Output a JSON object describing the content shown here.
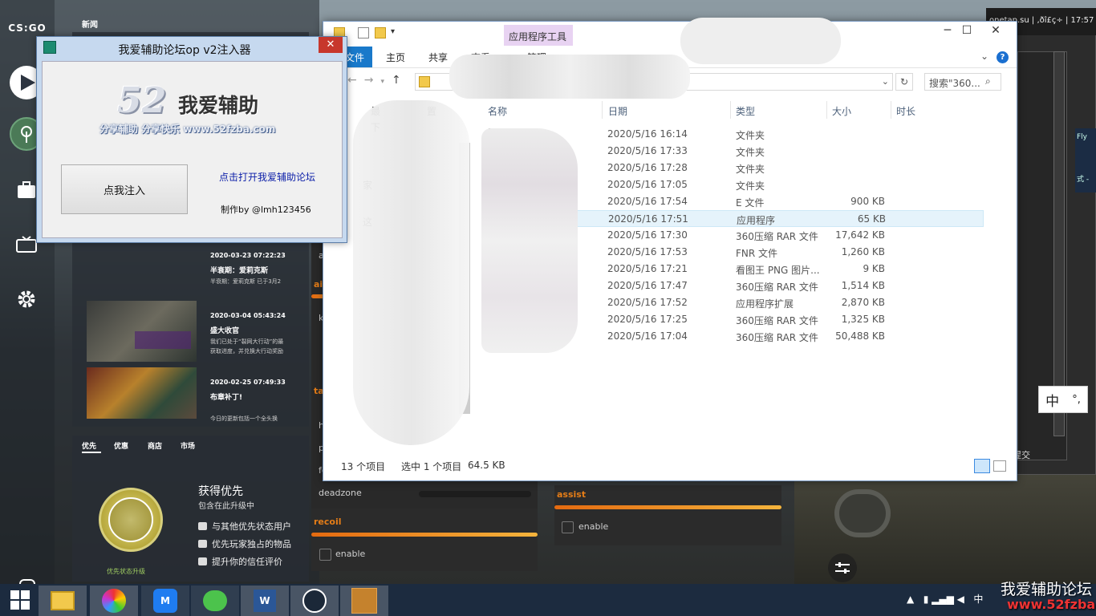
{
  "csgo": {
    "logo": "CS:GO",
    "news_header": "新闻",
    "news": [
      {
        "date": "2020-03-23 07:22:23",
        "title": "半衰期：爱莉克斯",
        "desc": "半衰期：爱莉克斯 已于3月2"
      },
      {
        "date": "2020-03-04 05:43:24",
        "title": "盛大收官",
        "desc": "我们已处于“裂网大行动”的最\n获取进度，并兑换大行动奖励"
      },
      {
        "date": "2020-02-25 07:49:33",
        "title": "布章补丁!",
        "desc": "今日的更新包括一个全头换"
      }
    ],
    "prime_tabs": [
      "优先",
      "优惠",
      "商店",
      "市场"
    ],
    "prime_title": "获得优先",
    "prime_sub": "包含在此升级中",
    "prime_items": [
      "与其他优先状态用户",
      "优先玩家独占的物品",
      "提升你的信任评价"
    ],
    "prime_upgrade": "优先状态升级"
  },
  "cheat": {
    "fragment_labels": [
      "a",
      "aim",
      "k",
      "tar",
      "h",
      "p",
      "fc"
    ],
    "deadzone_label": "deadzone",
    "recoil_head": "recoil",
    "recoil_enable": "enable",
    "assist_head": "assist",
    "assist_enable": "enable"
  },
  "overlay": {
    "header": "onetap.su | ,ðî£ç÷ | 17:57",
    "side_text": "Fly",
    "side_text2": "式 -",
    "submit_label": "提交",
    "ime_cn": "中",
    "ime_punct": "°,"
  },
  "injector": {
    "title": "我爱辅助论坛op v2注入器",
    "close": "✕",
    "logo_num": "52",
    "logo_cn": "我爱辅助",
    "logo_sub": "分享辅助 分享快乐 www.52fzba.com",
    "inject_button": "点我注入",
    "forum_link": "点击打开我爱辅助论坛",
    "author": "制作by @lmh123456"
  },
  "explorer": {
    "tool_label": "应用程序工具",
    "tabs": {
      "file": "文件",
      "home": "主页",
      "share": "共享",
      "view": "查看",
      "manage": "管理"
    },
    "search_placeholder": "搜索\"360...",
    "columns": {
      "name": "名称",
      "date": "日期",
      "type": "类型",
      "size": "大小",
      "duration": "时长"
    },
    "nav_items": [
      "最",
      "置",
      "下",
      "家",
      "这"
    ],
    "rows": [
      {
        "date": "2020/5/16 16:14",
        "type": "文件夹",
        "size": "",
        "icon": "folder"
      },
      {
        "date": "2020/5/16 17:33",
        "type": "文件夹",
        "size": "",
        "icon": "folder"
      },
      {
        "date": "2020/5/16 17:28",
        "type": "文件夹",
        "size": "",
        "icon": "folder"
      },
      {
        "date": "2020/5/16 17:05",
        "type": "文件夹",
        "size": "",
        "icon": "folder"
      },
      {
        "date": "2020/5/16 17:54",
        "type": "E 文件",
        "size": "900 KB",
        "icon": "file"
      },
      {
        "date": "2020/5/16 17:51",
        "type": "应用程序",
        "size": "65 KB",
        "icon": "exe",
        "selected": true
      },
      {
        "date": "2020/5/16 17:30",
        "type": "360压缩 RAR 文件",
        "size": "17,642 KB",
        "icon": "rar"
      },
      {
        "date": "2020/5/16 17:53",
        "type": "FNR 文件",
        "size": "1,260 KB",
        "icon": "file"
      },
      {
        "date": "2020/5/16 17:21",
        "type": "看图王 PNG 图片...",
        "size": "9 KB",
        "icon": "png"
      },
      {
        "date": "2020/5/16 17:47",
        "type": "360压缩 RAR 文件",
        "size": "1,514 KB",
        "icon": "rar"
      },
      {
        "date": "2020/5/16 17:52",
        "type": "应用程序扩展",
        "size": "2,870 KB",
        "icon": "dll"
      },
      {
        "date": "2020/5/16 17:25",
        "type": "360压缩 RAR 文件",
        "size": "1,325 KB",
        "icon": "rar"
      },
      {
        "date": "2020/5/16 17:04",
        "type": "360压缩 RAR 文件",
        "size": "50,488 KB",
        "icon": "rar"
      }
    ],
    "status_count": "13 个项目",
    "status_selected": "选中 1 个项目",
    "status_size": "64.5 KB"
  },
  "taskbar": {
    "apps": [
      "file-explorer",
      "360-browser",
      "lanxin",
      "wechat",
      "word",
      "steam",
      "csgo"
    ],
    "tray_text": "中",
    "watermark_1": "我爱辅助论坛",
    "watermark_2": "www.52fzba.com"
  },
  "colors": {
    "accent_orange": "#e57d17",
    "explorer_blue": "#1979ca",
    "selection": "#e5f3fb"
  }
}
